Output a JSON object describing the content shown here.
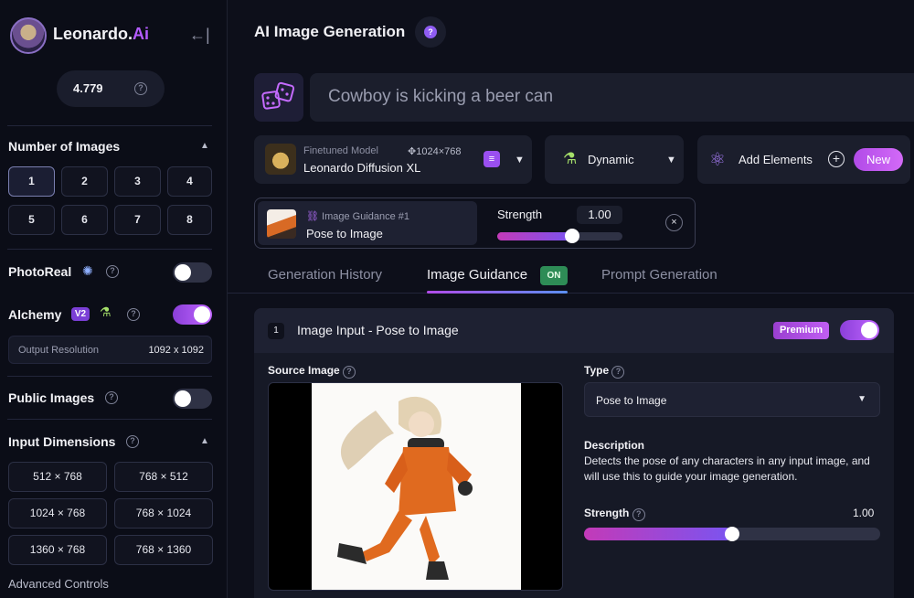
{
  "sidebar": {
    "brand_prefix": "Leonardo.",
    "brand_suffix": "Ai",
    "collapse_icon": "←|",
    "credits": "4.779",
    "number_of_images": {
      "title": "Number of Images",
      "options": [
        "1",
        "2",
        "3",
        "4",
        "5",
        "6",
        "7",
        "8"
      ],
      "selected": "1"
    },
    "photoreal": {
      "label": "PhotoReal",
      "enabled": false
    },
    "alchemy": {
      "label": "Alchemy",
      "badge": "V2",
      "enabled": true
    },
    "output_resolution": {
      "label": "Output Resolution",
      "value": "1092 x 1092"
    },
    "public_images": {
      "label": "Public Images",
      "enabled": false
    },
    "input_dimensions": {
      "title": "Input Dimensions",
      "options": [
        "512 × 768",
        "768 × 512",
        "1024 × 768",
        "768 × 1024",
        "1360 × 768",
        "768 × 1360"
      ]
    },
    "advanced_controls": "Advanced Controls"
  },
  "header": {
    "title": "AI Image Generation",
    "help": "?"
  },
  "prompt": {
    "placeholder": "Cowboy is kicking a beer can"
  },
  "model": {
    "kicker": "Finetuned Model",
    "dimensions": "1024×768",
    "name": "Leonardo Diffusion XL"
  },
  "style": {
    "label": "Dynamic"
  },
  "elements": {
    "label": "Add Elements",
    "new_label": "New"
  },
  "guidance": {
    "kicker": "Image Guidance #1",
    "name": "Pose to Image",
    "strength_label": "Strength",
    "strength_value": "1.00",
    "strength_fraction": 0.6,
    "close": "×"
  },
  "tabs": [
    {
      "label": "Generation History"
    },
    {
      "label": "Image Guidance",
      "badge": "ON"
    },
    {
      "label": "Prompt Generation"
    }
  ],
  "panel": {
    "step": "1",
    "title": "Image Input - Pose to Image",
    "premium": "Premium",
    "enabled": true,
    "source_label": "Source Image",
    "type_label": "Type",
    "type_value": "Pose to Image",
    "description_label": "Description",
    "description": "Detects the pose of any characters in any input image, and will use this to guide your image generation.",
    "strength_label": "Strength",
    "strength_value": "1.00",
    "strength_fraction": 0.5
  },
  "colors": {
    "accent": "#b45cff",
    "on_badge": "#2e8c56",
    "background": "#0d0f1a"
  }
}
